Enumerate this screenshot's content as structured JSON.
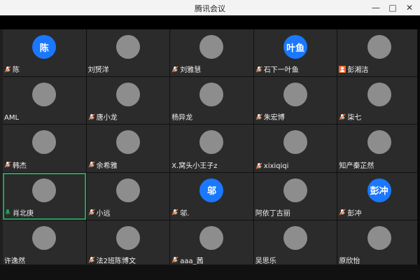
{
  "window": {
    "title": "腾讯会议"
  },
  "colors": {
    "accent_blue": "#1a78ff",
    "active_green": "#23a05c",
    "mic_orange": "#f06b2c",
    "mic_green": "#23a05c"
  },
  "participants": [
    {
      "name": "陈",
      "avatar_text": "陈",
      "avatar_type": "text",
      "mic": "muted"
    },
    {
      "name": "刘赟洋",
      "avatar_type": "photo",
      "mic": ""
    },
    {
      "name": "刘雅慧",
      "avatar_type": "photo",
      "mic": "muted"
    },
    {
      "name": "石下一叶鱼",
      "avatar_text": "叶鱼",
      "avatar_type": "text",
      "mic": "muted"
    },
    {
      "name": "彭湘洁",
      "avatar_type": "photo",
      "mic": "person"
    },
    {
      "name": "AML",
      "avatar_type": "photo",
      "mic": ""
    },
    {
      "name": "唐小龙",
      "avatar_type": "photo",
      "mic": "muted"
    },
    {
      "name": "杨异龙",
      "avatar_type": "photo",
      "mic": ""
    },
    {
      "name": "朱宏博",
      "avatar_type": "photo",
      "mic": "muted"
    },
    {
      "name": "柒七",
      "avatar_type": "photo",
      "mic": "muted"
    },
    {
      "name": "韩杰",
      "avatar_type": "photo",
      "mic": "muted"
    },
    {
      "name": "余希雅",
      "avatar_type": "photo",
      "mic": "muted"
    },
    {
      "name": "X.窝头小王子z",
      "avatar_type": "photo",
      "mic": ""
    },
    {
      "name": "xixiqiqi",
      "avatar_type": "photo",
      "mic": "muted"
    },
    {
      "name": "知产秦芷然",
      "avatar_type": "photo",
      "mic": ""
    },
    {
      "name": "肖北庚",
      "avatar_type": "photo",
      "mic": "speaking",
      "active": true
    },
    {
      "name": "小远",
      "avatar_type": "photo",
      "mic": "muted"
    },
    {
      "name": "邬.",
      "avatar_text": "邬",
      "avatar_type": "text",
      "mic": "muted"
    },
    {
      "name": "阿依丁古丽",
      "avatar_type": "photo",
      "mic": ""
    },
    {
      "name": "彭冲",
      "avatar_text": "彭冲",
      "avatar_type": "text",
      "mic": "muted"
    },
    {
      "name": "许逸然",
      "avatar_type": "photo",
      "mic": ""
    },
    {
      "name": "法2班陈博文",
      "avatar_type": "photo",
      "mic": "muted"
    },
    {
      "name": "aaa_茜",
      "avatar_type": "photo",
      "mic": "muted"
    },
    {
      "name": "吴思乐",
      "avatar_type": "photo",
      "mic": ""
    },
    {
      "name": "原欣怡",
      "avatar_type": "photo",
      "mic": ""
    }
  ]
}
